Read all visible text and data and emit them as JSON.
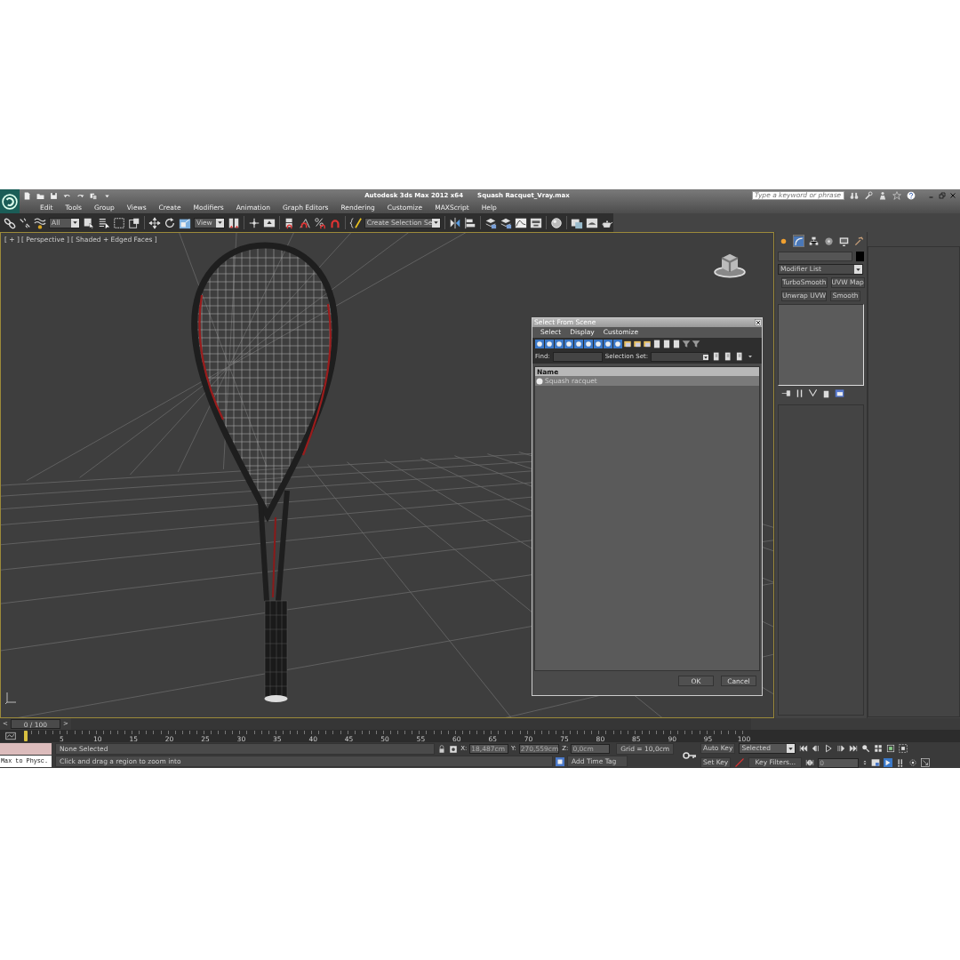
{
  "title_bar": {
    "app": "Autodesk 3ds Max  2012 x64",
    "file": "Squash Racquet_Vray.max",
    "search": {
      "placeholder": "Type a keyword or phrase"
    }
  },
  "menu": [
    "Edit",
    "Tools",
    "Group",
    "Views",
    "Create",
    "Modifiers",
    "Animation",
    "Graph Editors",
    "Rendering",
    "Customize",
    "MAXScript",
    "Help"
  ],
  "toolbar": {
    "selection_filter": "All",
    "reference_coordinate": "View",
    "named_selection": "Create Selection Se"
  },
  "viewport": {
    "labels": [
      "[ + ]",
      "[ Perspective ]",
      "[ Shaded + Edged Faces ]"
    ]
  },
  "dialog": {
    "title": "Select From Scene",
    "menu": [
      "Select",
      "Display",
      "Customize"
    ],
    "find_label": "Find:",
    "selection_set_label": "Selection Set:",
    "column": "Name",
    "rows": [
      {
        "name": "Squash racquet",
        "selected": true
      }
    ],
    "buttons": [
      "OK",
      "Cancel"
    ]
  },
  "command_panel": {
    "tabs": [
      {
        "kind": "create",
        "selected": false
      },
      {
        "kind": "modify",
        "selected": true
      },
      {
        "kind": "hierarchy",
        "selected": false
      },
      {
        "kind": "motion",
        "selected": false
      },
      {
        "kind": "display",
        "selected": false
      },
      {
        "kind": "utilities",
        "selected": false
      }
    ],
    "modifier_list": "Modifier List",
    "modifier_buttons": [
      "TurboSmooth",
      "UVW Map",
      "Unwrap UVW",
      "Smooth"
    ]
  },
  "timeline": {
    "previous": "<",
    "frame": "0 / 100",
    "level": 0,
    "next": ">",
    "ticks": [
      "5",
      "10",
      "15",
      "20",
      "25",
      "30",
      "35",
      "40",
      "45",
      "50",
      "55",
      "60",
      "65",
      "70",
      "75",
      "80",
      "85",
      "90",
      "95",
      "100"
    ]
  },
  "status": {
    "listener": "Max to Physc.",
    "selection": "None Selected",
    "prompt": "Click and drag a region to zoom into",
    "x_label": "X:",
    "x": "18,487cm",
    "y_label": "Y:",
    "y": "270,559cm",
    "z_label": "Z:",
    "z": "0,0cm",
    "grid": "Grid = 10,0cm",
    "add_time_tag": "Add Time Tag"
  },
  "animation": {
    "auto_key": "Auto Key",
    "set_key": "Set Key",
    "key_mode": "Selected",
    "key_filters": "Key Filters...",
    "frame": "0"
  }
}
